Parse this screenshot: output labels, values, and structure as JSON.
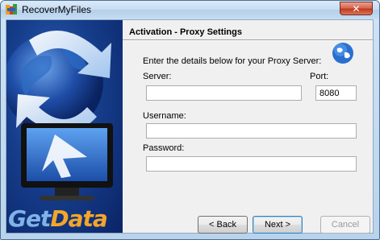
{
  "window": {
    "title": "RecoverMyFiles"
  },
  "banner": {
    "brand_part1": "Get",
    "brand_part2": "Data"
  },
  "page": {
    "heading": "Activation - Proxy Settings",
    "intro": "Enter the details below for your Proxy Server:"
  },
  "form": {
    "server_label": "Server:",
    "server_value": "",
    "port_label": "Port:",
    "port_value": "8080",
    "username_label": "Username:",
    "username_value": "",
    "password_label": "Password:",
    "password_value": ""
  },
  "buttons": {
    "back": "< Back",
    "next": "Next >",
    "cancel": "Cancel"
  },
  "icons": {
    "app": "recovermyfiles-logo-icon",
    "close": "close-icon",
    "globe": "globe-icon"
  },
  "colors": {
    "close_button": "#c2391b",
    "brand_get": "#7fb2e8",
    "brand_data": "#f3a62a",
    "banner_blue": "#163e8c"
  }
}
